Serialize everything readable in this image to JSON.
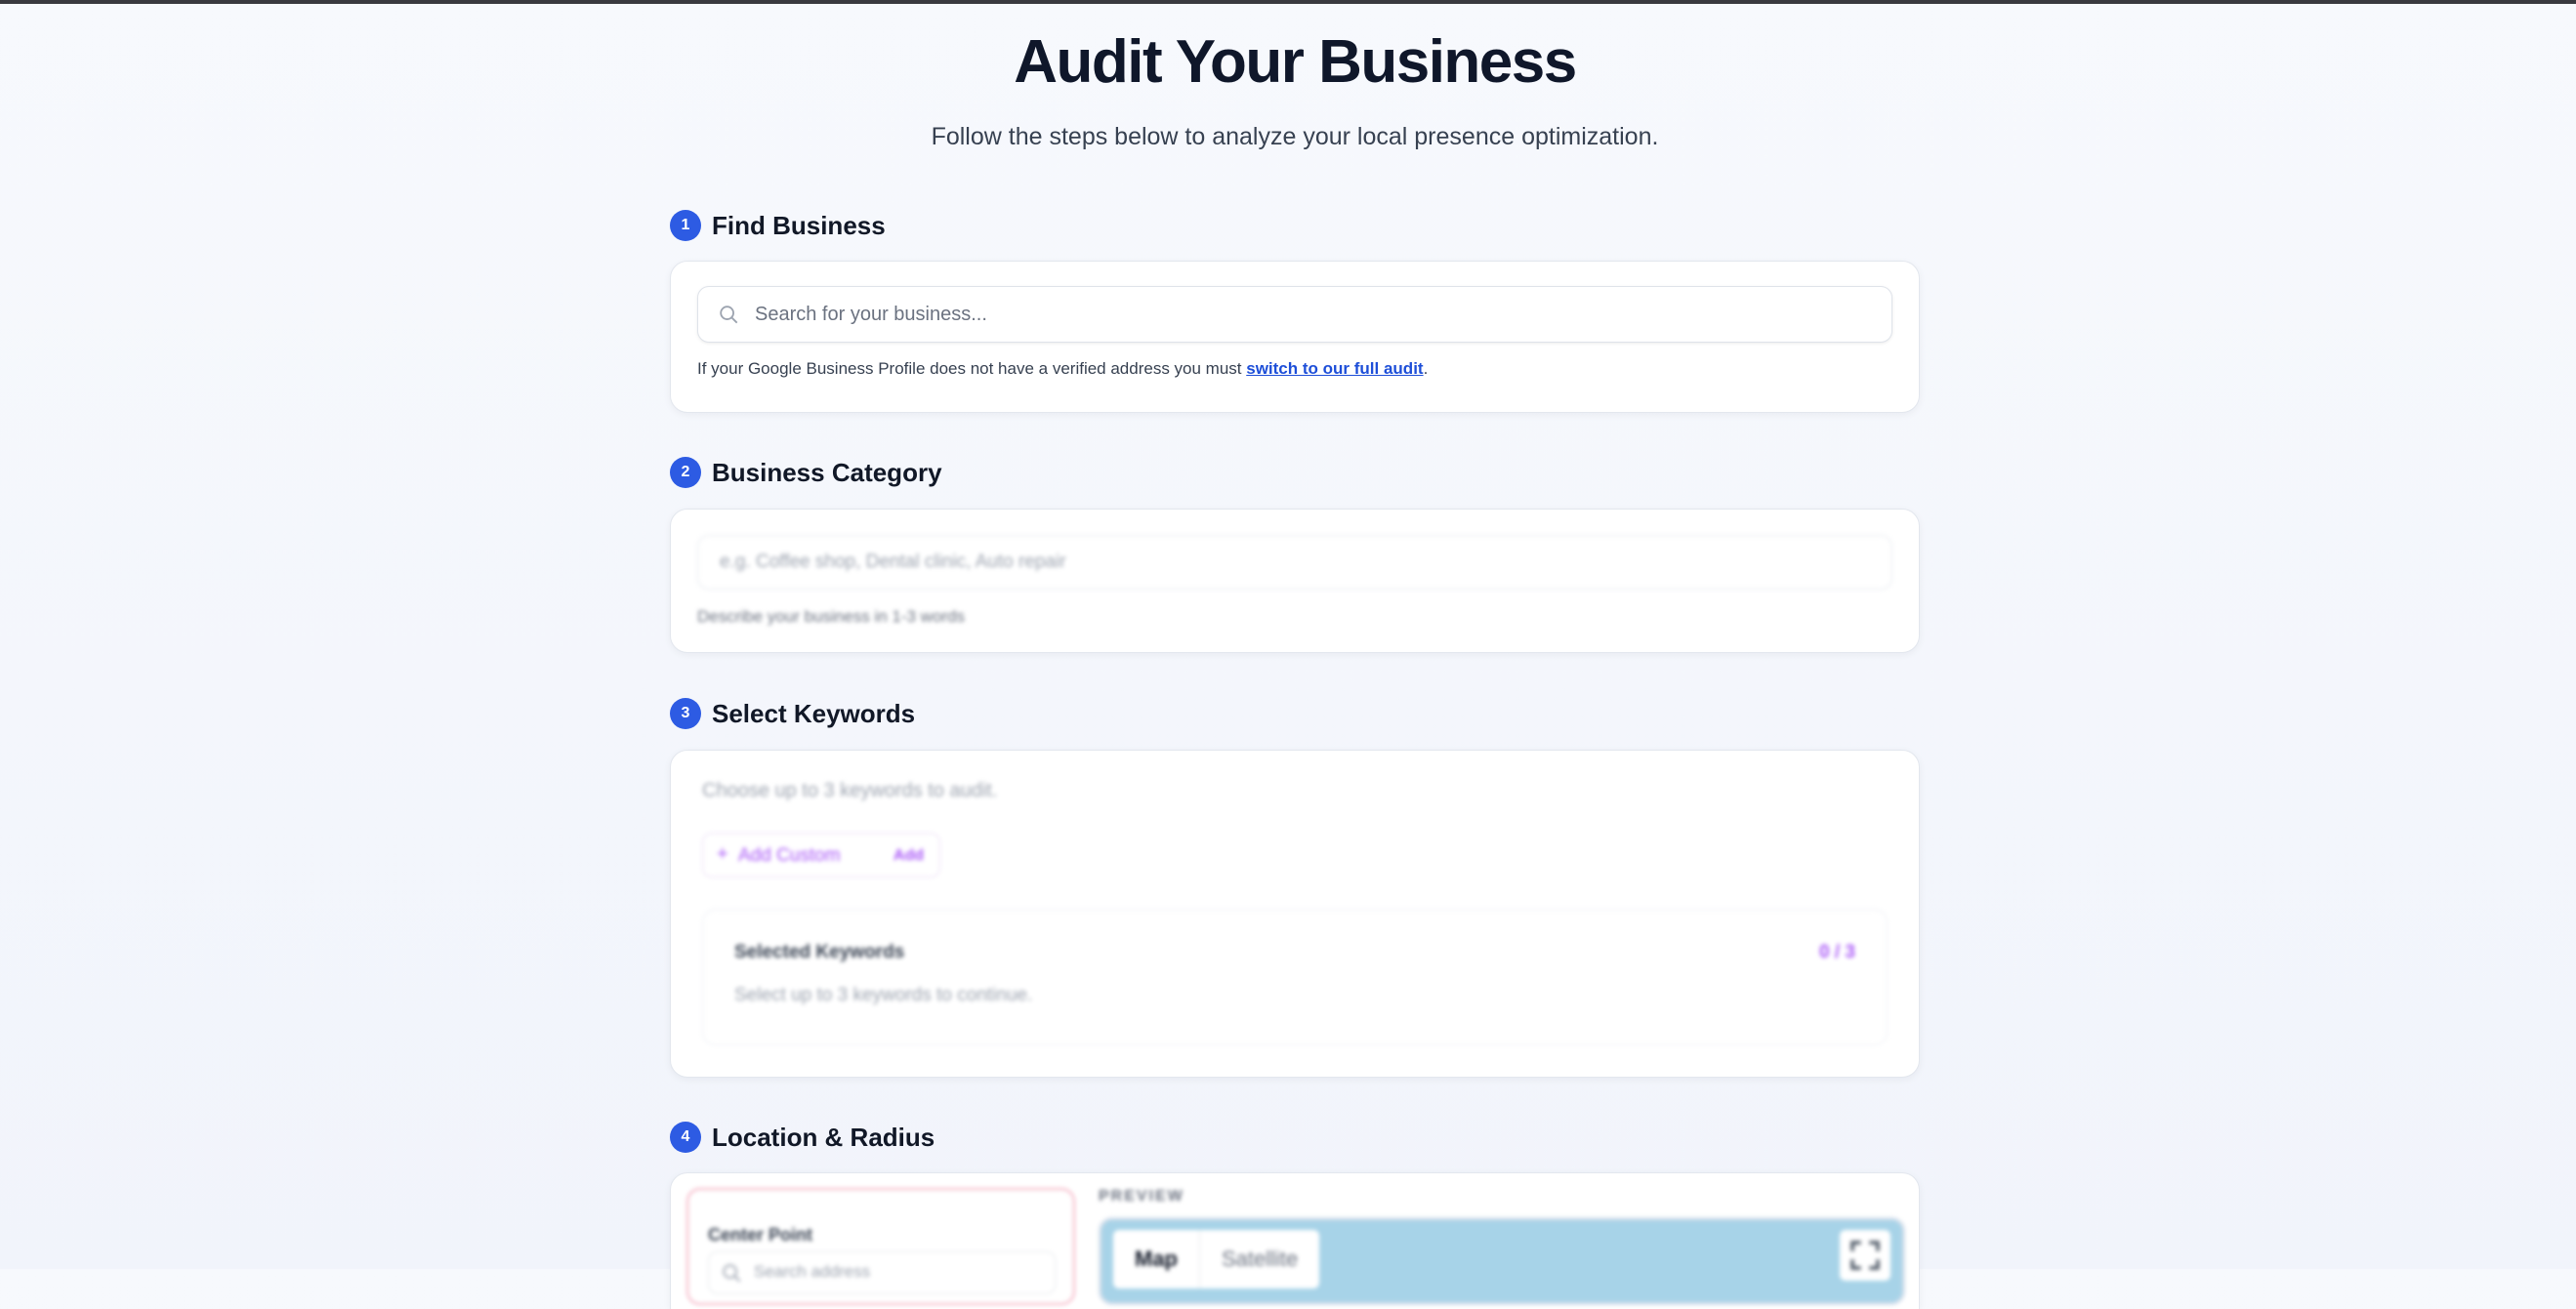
{
  "header": {
    "title": "Audit Your Business",
    "subtitle": "Follow the steps below to analyze your local presence optimization."
  },
  "steps": {
    "find": {
      "number": "1",
      "title": "Find Business",
      "search_placeholder": "Search for your business...",
      "note_prefix": "If your Google Business Profile does not have a verified address you must ",
      "note_link": "switch to our full audit",
      "note_suffix": "."
    },
    "category": {
      "number": "2",
      "title": "Business Category",
      "input_placeholder": "e.g. Coffee shop, Dental clinic, Auto repair",
      "hint": "Describe your business in 1-3 words"
    },
    "keywords": {
      "number": "3",
      "title": "Select Keywords",
      "hint": "Choose up to 3 keywords to audit.",
      "add_custom_icon": "+",
      "add_custom_label": "Add Custom",
      "add_button": "Add",
      "selected_title": "Selected Keywords",
      "selected_count": "0 / 3",
      "selected_hint": "Select up to 3 keywords to continue."
    },
    "location": {
      "number": "4",
      "title": "Location & Radius",
      "center_point_title": "Center Point",
      "address_placeholder": "Search address",
      "preview_label": "PREVIEW",
      "map_tabs": [
        "Map",
        "Satellite"
      ]
    }
  },
  "icons": {
    "search": "search-icon",
    "fullscreen": "fullscreen-icon"
  },
  "colors": {
    "accent": "#2d5be3",
    "purple": "#a855f7",
    "link": "#1d4ed8",
    "map_water": "#a7d3e8"
  }
}
